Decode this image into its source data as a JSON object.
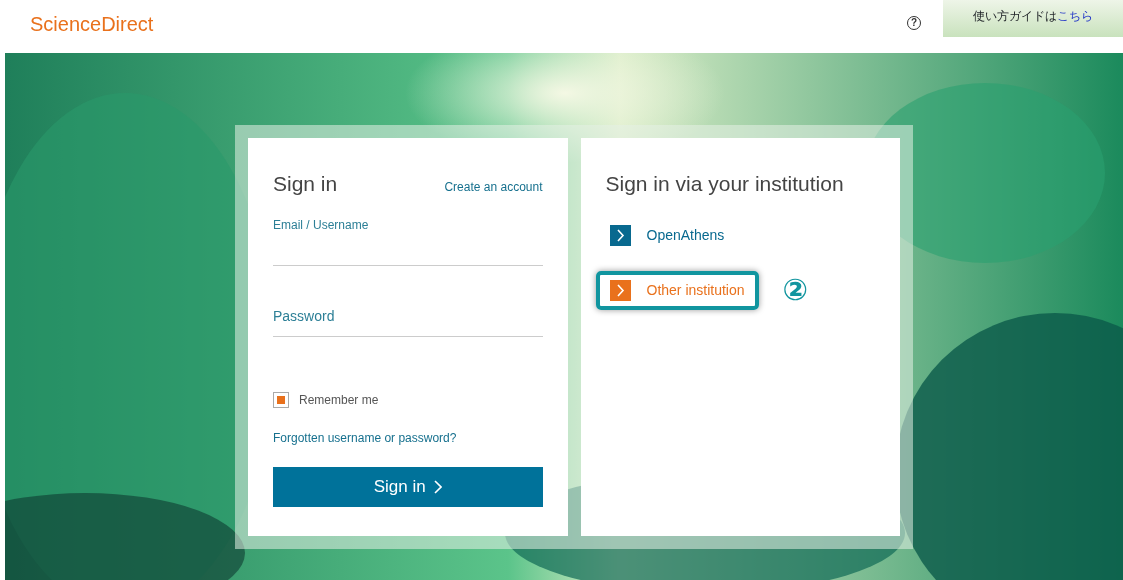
{
  "header": {
    "logo": "ScienceDirect",
    "help": "?",
    "guide": {
      "text": "使い方ガイドは",
      "link": "こちら"
    }
  },
  "sign_in": {
    "title": "Sign in",
    "create_account": "Create an account",
    "email_label": "Email / Username",
    "password_label": "Password",
    "remember": {
      "label": "Remember me",
      "checked": true
    },
    "forgot": "Forgotten username or password?",
    "button": "Sign in"
  },
  "institution": {
    "title": "Sign in via your institution",
    "options": [
      {
        "label": "OpenAthens",
        "color": "#08698f",
        "highlighted": false
      },
      {
        "label": "Other institution",
        "color": "#e9711c",
        "highlighted": true
      }
    ],
    "step_marker": "②"
  }
}
